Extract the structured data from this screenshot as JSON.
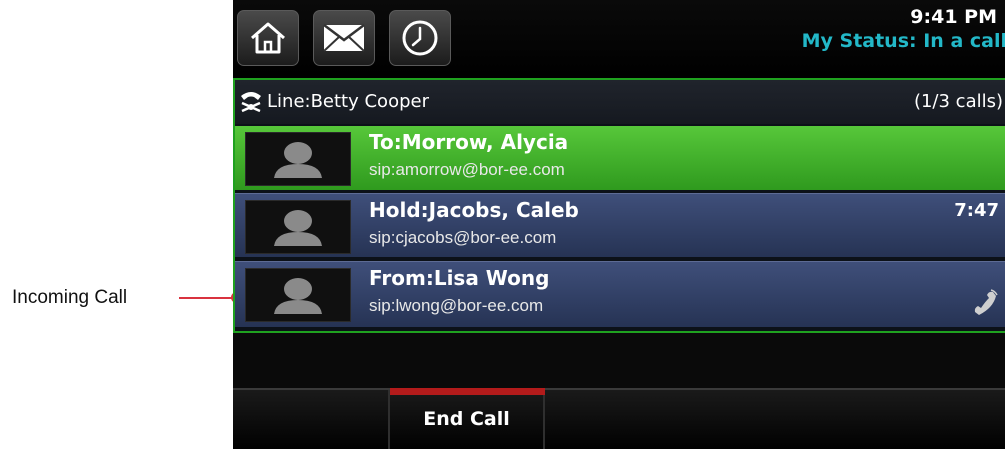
{
  "callout": {
    "label": "Incoming Call",
    "color": "#d9333f"
  },
  "header": {
    "nav_buttons": [
      {
        "icon": "home-icon"
      },
      {
        "icon": "mail-icon"
      },
      {
        "icon": "clock-icon"
      }
    ],
    "time": "9:41 PM",
    "status": "My Status: In a call",
    "status_color": "#23b8c8"
  },
  "line": {
    "label": "Line:Betty Cooper",
    "icon": "line-icon",
    "call_count": "(1/3 calls)"
  },
  "calls": [
    {
      "name": "To:Morrow, Alycia",
      "sip": "sip:amorrow@bor-ee.com",
      "state": "active",
      "timer": ""
    },
    {
      "name": "Hold:Jacobs, Caleb",
      "sip": "sip:cjacobs@bor-ee.com",
      "state": "hold",
      "timer": "7:47"
    },
    {
      "name": "From:Lisa Wong",
      "sip": "sip:lwong@bor-ee.com",
      "state": "incoming",
      "timer": "",
      "icon": "handset-icon"
    }
  ],
  "softkeys": {
    "end_call": "End Call"
  },
  "colors": {
    "active_row": "#3fae2a",
    "row_bg": "#2f3c64",
    "frame_border": "#1fa11f",
    "end_call_accent": "#b31b1b"
  }
}
